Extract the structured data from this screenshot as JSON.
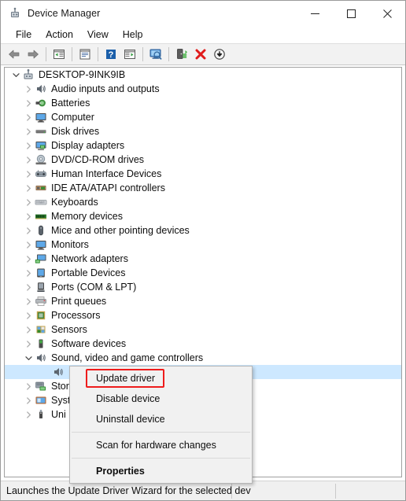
{
  "window": {
    "title": "Device Manager",
    "icon": "device-manager-icon",
    "controls": {
      "minimize": "minimize-icon",
      "maximize": "maximize-icon",
      "close": "close-icon"
    }
  },
  "menubar": {
    "items": [
      {
        "label": "File",
        "name": "menu-file"
      },
      {
        "label": "Action",
        "name": "menu-action"
      },
      {
        "label": "View",
        "name": "menu-view"
      },
      {
        "label": "Help",
        "name": "menu-help"
      }
    ]
  },
  "toolbar": {
    "buttons": [
      {
        "name": "back-button",
        "icon": "back-arrow-icon"
      },
      {
        "name": "forward-button",
        "icon": "forward-arrow-icon"
      },
      {
        "name": "separator-1",
        "icon": "separator"
      },
      {
        "name": "show-hide-console-tree-button",
        "icon": "console-tree-icon"
      },
      {
        "name": "separator-2",
        "icon": "separator"
      },
      {
        "name": "properties-button",
        "icon": "properties-icon"
      },
      {
        "name": "separator-3",
        "icon": "separator"
      },
      {
        "name": "help-button",
        "icon": "help-question-icon"
      },
      {
        "name": "show-hide-action-pane-button",
        "icon": "action-pane-icon"
      },
      {
        "name": "separator-4",
        "icon": "separator"
      },
      {
        "name": "scan-for-hardware-changes-button",
        "icon": "scan-monitor-icon"
      },
      {
        "name": "separator-5",
        "icon": "separator"
      },
      {
        "name": "update-driver-button",
        "icon": "update-driver-icon"
      },
      {
        "name": "uninstall-device-button",
        "icon": "red-x-icon"
      },
      {
        "name": "disable-device-button",
        "icon": "down-arrow-circle-icon"
      }
    ]
  },
  "tree": {
    "root": {
      "label": "DESKTOP-9INK9IB",
      "icon": "computer-root-icon",
      "expanded": true
    },
    "nodes": [
      {
        "label": "Audio inputs and outputs",
        "icon": "speaker-icon",
        "indent": 1,
        "expanded": false
      },
      {
        "label": "Batteries",
        "icon": "battery-icon",
        "indent": 1,
        "expanded": false
      },
      {
        "label": "Computer",
        "icon": "monitor-icon",
        "indent": 1,
        "expanded": false
      },
      {
        "label": "Disk drives",
        "icon": "disk-drive-icon",
        "indent": 1,
        "expanded": false
      },
      {
        "label": "Display adapters",
        "icon": "display-adapter-icon",
        "indent": 1,
        "expanded": false
      },
      {
        "label": "DVD/CD-ROM drives",
        "icon": "optical-drive-icon",
        "indent": 1,
        "expanded": false
      },
      {
        "label": "Human Interface Devices",
        "icon": "hid-icon",
        "indent": 1,
        "expanded": false
      },
      {
        "label": "IDE ATA/ATAPI controllers",
        "icon": "ide-controller-icon",
        "indent": 1,
        "expanded": false
      },
      {
        "label": "Keyboards",
        "icon": "keyboard-icon",
        "indent": 1,
        "expanded": false
      },
      {
        "label": "Memory devices",
        "icon": "memory-icon",
        "indent": 1,
        "expanded": false
      },
      {
        "label": "Mice and other pointing devices",
        "icon": "mouse-icon",
        "indent": 1,
        "expanded": false
      },
      {
        "label": "Monitors",
        "icon": "monitor-icon",
        "indent": 1,
        "expanded": false
      },
      {
        "label": "Network adapters",
        "icon": "network-adapter-icon",
        "indent": 1,
        "expanded": false
      },
      {
        "label": "Portable Devices",
        "icon": "portable-device-icon",
        "indent": 1,
        "expanded": false
      },
      {
        "label": "Ports (COM & LPT)",
        "icon": "port-icon",
        "indent": 1,
        "expanded": false
      },
      {
        "label": "Print queues",
        "icon": "printer-icon",
        "indent": 1,
        "expanded": false
      },
      {
        "label": "Processors",
        "icon": "processor-icon",
        "indent": 1,
        "expanded": false
      },
      {
        "label": "Sensors",
        "icon": "sensor-icon",
        "indent": 1,
        "expanded": false
      },
      {
        "label": "Software devices",
        "icon": "software-device-icon",
        "indent": 1,
        "expanded": false
      },
      {
        "label": "Sound, video and game controllers",
        "icon": "speaker-icon",
        "indent": 1,
        "expanded": true
      },
      {
        "label": "",
        "icon": "speaker-icon",
        "indent": 2,
        "selected": true
      },
      {
        "label": "Stor",
        "icon": "storage-controller-icon",
        "indent": 1,
        "expanded": false
      },
      {
        "label": "Syst",
        "icon": "system-device-icon",
        "indent": 1,
        "expanded": false
      },
      {
        "label": "Uni",
        "icon": "usb-controller-icon",
        "indent": 1,
        "expanded": false
      }
    ]
  },
  "context_menu": {
    "items": [
      {
        "label": "Update driver",
        "name": "ctx-update-driver",
        "bold": false,
        "highlighted": true
      },
      {
        "label": "Disable device",
        "name": "ctx-disable-device",
        "bold": false
      },
      {
        "label": "Uninstall device",
        "name": "ctx-uninstall-device",
        "bold": false
      },
      {
        "label": "Scan for hardware changes",
        "name": "ctx-scan-for-hardware-changes",
        "bold": false
      },
      {
        "label": "Properties",
        "name": "ctx-properties",
        "bold": true
      }
    ],
    "highlight_color": "#ee1c1c"
  },
  "statusbar": {
    "text": "Launches the Update Driver Wizard for the selected dev"
  }
}
